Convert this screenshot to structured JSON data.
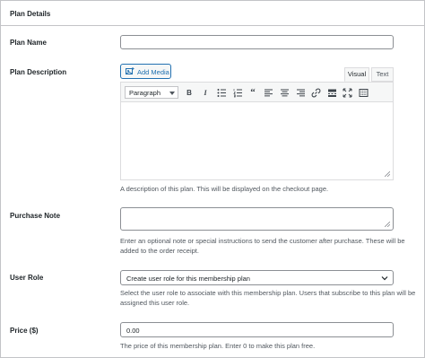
{
  "panel": {
    "title": "Plan Details"
  },
  "plan_name": {
    "label": "Plan Name",
    "value": ""
  },
  "plan_description": {
    "label": "Plan Description",
    "add_media": "Add Media",
    "tabs": [
      "Visual",
      "Text"
    ],
    "format_select": "Paragraph",
    "help": "A description of this plan. This will be displayed on the checkout page."
  },
  "purchase_note": {
    "label": "Purchase Note",
    "value": "",
    "help": "Enter an optional note or special instructions to send the customer after purchase. These will be added to the order receipt."
  },
  "user_role": {
    "label": "User Role",
    "selected": "Create user role for this membership plan",
    "help": "Select the user role to associate with this membership plan. Users that subscribe to this plan will be assigned this user role."
  },
  "price": {
    "label": "Price ($)",
    "value": "0.00",
    "help": "The price of this membership plan. Enter 0 to make this plan free."
  },
  "toolbar_icons": [
    "bold-icon",
    "italic-icon",
    "bullet-list-icon",
    "numbered-list-icon",
    "blockquote-icon",
    "align-left-icon",
    "align-center-icon",
    "align-right-icon",
    "link-icon",
    "read-more-icon",
    "fullscreen-icon",
    "toolbar-toggle-icon"
  ]
}
